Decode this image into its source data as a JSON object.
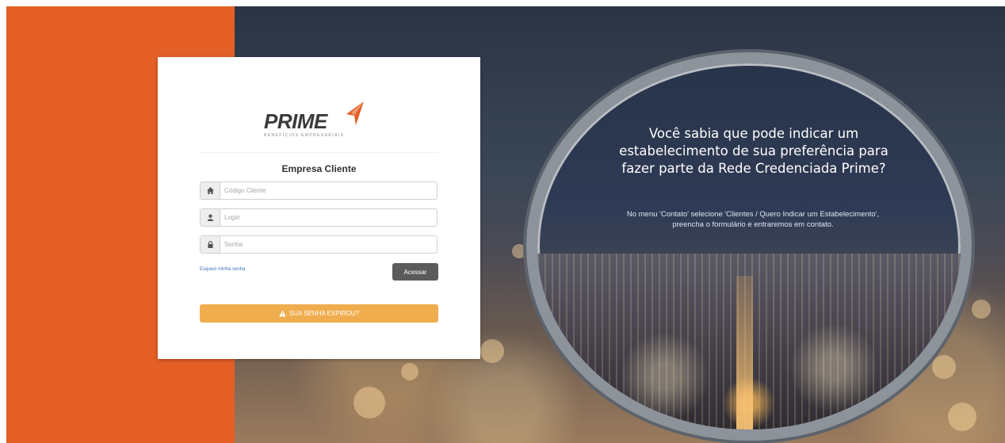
{
  "brand": {
    "name": "PRIME",
    "tagline": "BENEFÍCIOS EMPRESARIAIS",
    "accent_color": "#e35f26"
  },
  "login": {
    "title": "Empresa Cliente",
    "client_code": {
      "icon": "home-icon",
      "placeholder": "Código Cliente",
      "value": ""
    },
    "username": {
      "icon": "user-icon",
      "placeholder": "Login",
      "value": ""
    },
    "password": {
      "icon": "lock-icon",
      "placeholder": "Senha",
      "value": ""
    },
    "forgot_link": "Esqueci minha senha",
    "submit_label": "Acessar",
    "expired_label": "SUA SENHA EXPIROU?",
    "expired_icon": "warning-icon",
    "expired_color": "#f0ad4e"
  },
  "promo": {
    "headline_lines": [
      "Você sabia que pode indicar um",
      "estabelecimento de sua preferência para",
      "fazer parte da Rede Credenciada Prime?"
    ],
    "sub_lines": [
      "No menu 'Contato' selecione 'Clientes / Quero Indicar um Estabelecimento',",
      "preencha o formulário e entraremos em contato."
    ]
  }
}
